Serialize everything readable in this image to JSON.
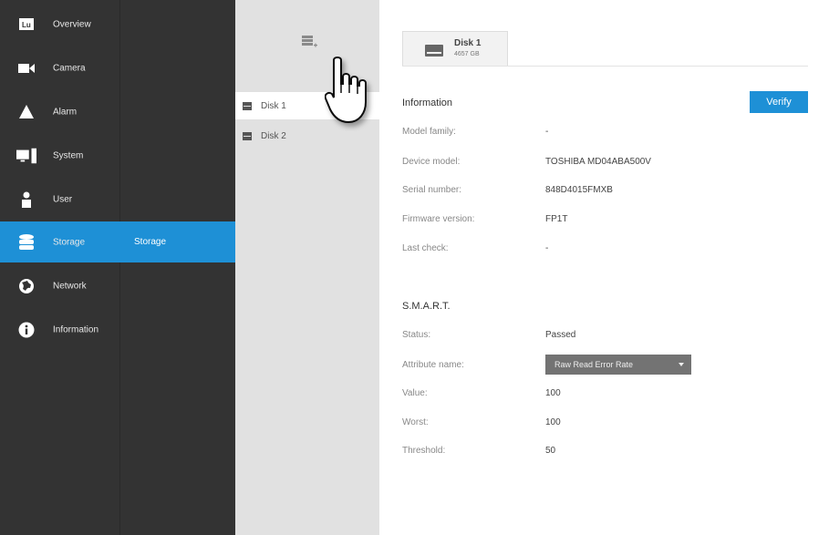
{
  "nav": {
    "items": [
      {
        "label": "Overview",
        "icon": "overview-icon"
      },
      {
        "label": "Camera",
        "icon": "camera-icon"
      },
      {
        "label": "Alarm",
        "icon": "alarm-icon"
      },
      {
        "label": "System",
        "icon": "system-icon"
      },
      {
        "label": "User",
        "icon": "user-icon"
      },
      {
        "label": "Storage",
        "icon": "storage-icon"
      },
      {
        "label": "Network",
        "icon": "network-icon"
      },
      {
        "label": "Information",
        "icon": "information-icon"
      }
    ],
    "active_index": 5,
    "sub_item": "Storage"
  },
  "disks": {
    "add_icon": "add-disk-icon",
    "list": [
      {
        "label": "Disk 1"
      },
      {
        "label": "Disk 2"
      }
    ],
    "selected_index": 0
  },
  "tab": {
    "name": "Disk 1",
    "size": "4657 GB"
  },
  "information": {
    "title": "Information",
    "verify_label": "Verify",
    "fields": [
      {
        "label": "Model family:",
        "value": "-"
      },
      {
        "label": "Device model:",
        "value": "TOSHIBA MD04ABA500V"
      },
      {
        "label": "Serial number:",
        "value": "848D4015FMXB"
      },
      {
        "label": "Firmware version:",
        "value": "FP1T"
      },
      {
        "label": "Last check:",
        "value": "-"
      }
    ]
  },
  "smart": {
    "title": "S.M.A.R.T.",
    "status_label": "Status:",
    "status_value": "Passed",
    "attribute_label": "Attribute name:",
    "attribute_value": "Raw Read Error Rate",
    "fields": [
      {
        "label": "Value:",
        "value": "100"
      },
      {
        "label": "Worst:",
        "value": "100"
      },
      {
        "label": "Threshold:",
        "value": "50"
      }
    ]
  },
  "colors": {
    "accent": "#1e90d6",
    "sidebar": "#333333",
    "panel": "#e1e1e1"
  }
}
